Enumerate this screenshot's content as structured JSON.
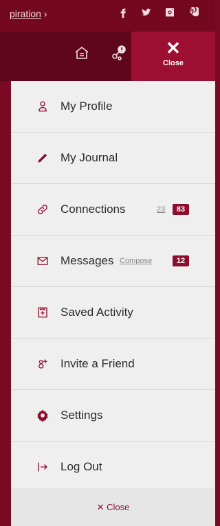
{
  "topbar": {
    "breadcrumb": "piration",
    "chevron": "›",
    "social": [
      {
        "icon": "facebook-icon"
      },
      {
        "icon": "twitter-icon"
      },
      {
        "icon": "instagram-icon"
      },
      {
        "icon": "pinterest-icon"
      }
    ]
  },
  "header": {
    "icons": [
      "home-icon",
      "connections-alert-icon"
    ],
    "close_x": "✕",
    "close_label": "Close"
  },
  "menu": {
    "items": [
      {
        "label": "My Profile",
        "icon": "user-icon"
      },
      {
        "label": "My Journal",
        "icon": "pencil-icon"
      },
      {
        "label": "Connections",
        "icon": "link-icon",
        "count": "23",
        "badge": "83"
      },
      {
        "label": "Messages",
        "icon": "envelope-icon",
        "compose": "Compose",
        "badge": "12"
      },
      {
        "label": "Saved Activity",
        "icon": "bookmark-plus-icon"
      },
      {
        "label": "Invite a Friend",
        "icon": "add-user-icon"
      },
      {
        "label": "Settings",
        "icon": "gear-icon"
      },
      {
        "label": "Log Out",
        "icon": "logout-icon"
      }
    ]
  },
  "footer": {
    "close_label": "✕ Close"
  },
  "colors": {
    "brand": "#8e0d2d",
    "header_dark": "#5f061d",
    "close_bg": "#9d0f32"
  }
}
